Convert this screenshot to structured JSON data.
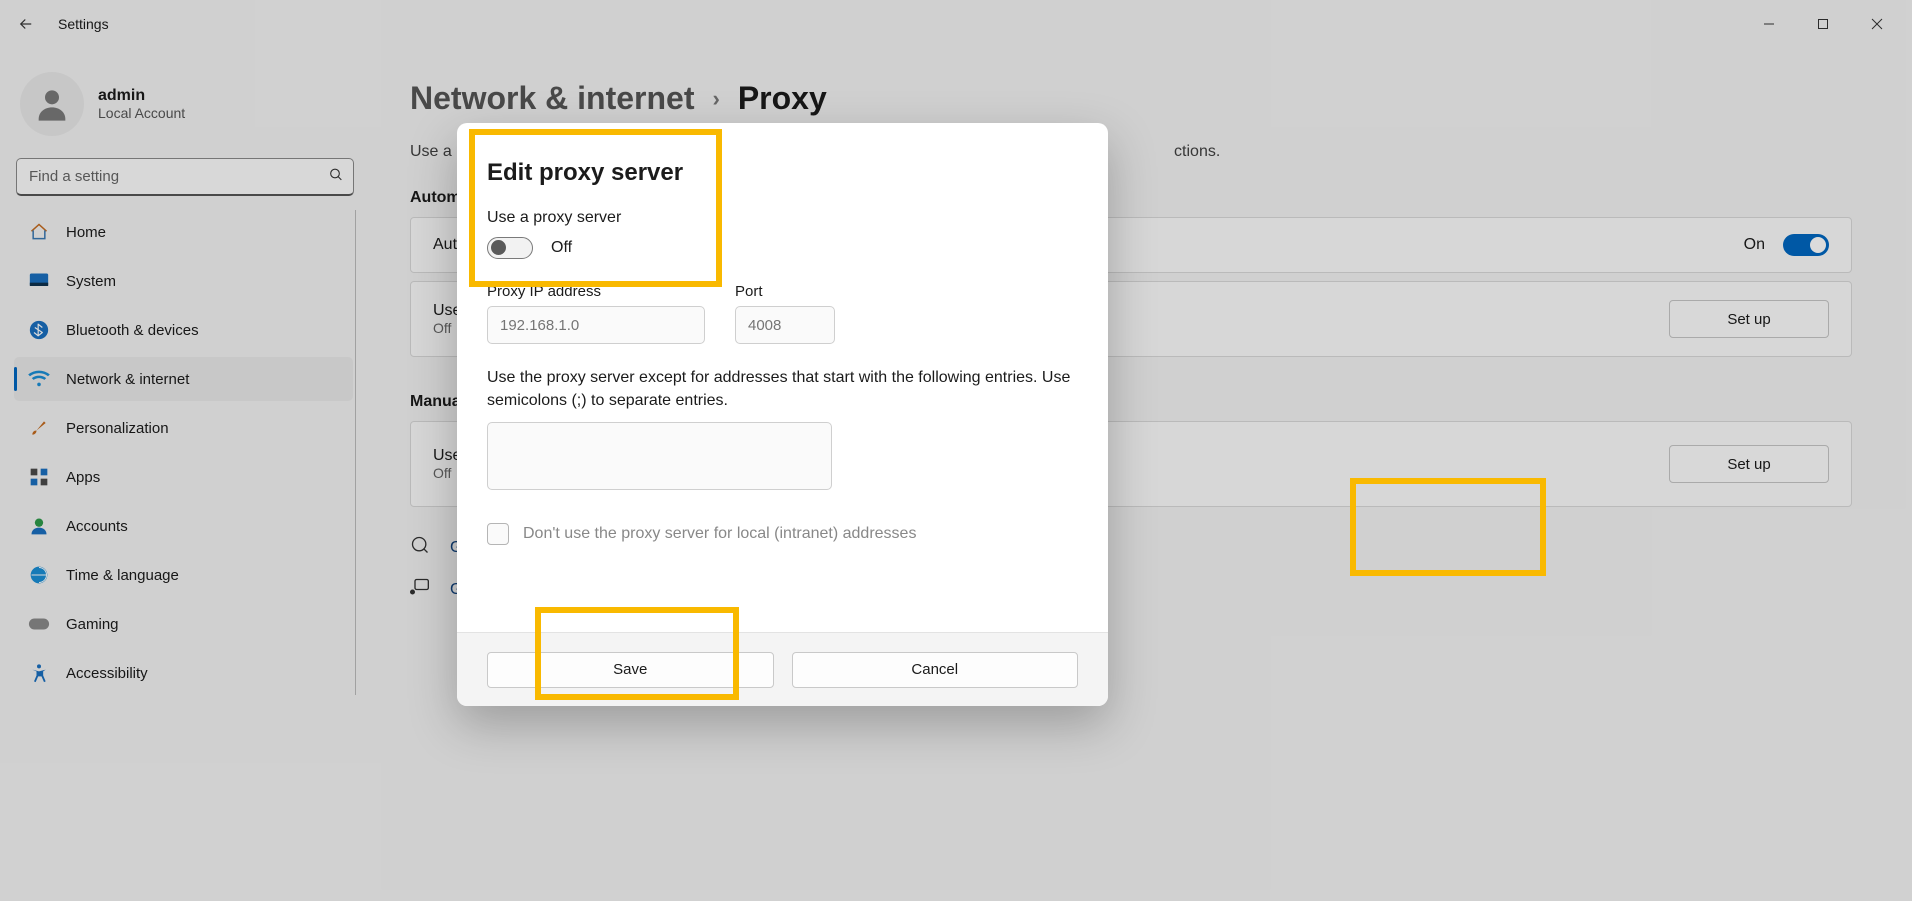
{
  "window": {
    "app_title": "Settings"
  },
  "user": {
    "name": "admin",
    "subtitle": "Local Account"
  },
  "search": {
    "placeholder": "Find a setting"
  },
  "sidebar": {
    "items": [
      {
        "label": "Home"
      },
      {
        "label": "System"
      },
      {
        "label": "Bluetooth & devices"
      },
      {
        "label": "Network & internet"
      },
      {
        "label": "Personalization"
      },
      {
        "label": "Apps"
      },
      {
        "label": "Accounts"
      },
      {
        "label": "Time & language"
      },
      {
        "label": "Gaming"
      },
      {
        "label": "Accessibility"
      }
    ],
    "selected_index": 3
  },
  "breadcrumb": {
    "parent": "Network & internet",
    "current": "Proxy"
  },
  "page": {
    "description_prefix": "Use a p",
    "description_suffix": "ctions.",
    "auto_section": "Automa",
    "auto_card_title": "Auto",
    "auto_card_state": "On",
    "script_card_title": "Use s",
    "script_card_sub": "Off",
    "setup_label": "Set up",
    "manual_section": "Manual",
    "manual_card_title": "Use a",
    "manual_card_sub": "Off",
    "link_help": "Ge",
    "link_feedback": "Giv"
  },
  "modal": {
    "title": "Edit proxy server",
    "use_proxy_label": "Use a proxy server",
    "toggle_state": "Off",
    "ip_label": "Proxy IP address",
    "ip_placeholder": "192.168.1.0",
    "port_label": "Port",
    "port_placeholder": "4008",
    "except_label": "Use the proxy server except for addresses that start with the following entries. Use semicolons (;) to separate entries.",
    "local_checkbox": "Don't use the proxy server for local (intranet) addresses",
    "save": "Save",
    "cancel": "Cancel"
  },
  "colors": {
    "accent": "#0067c0",
    "highlight": "#f9b900"
  }
}
